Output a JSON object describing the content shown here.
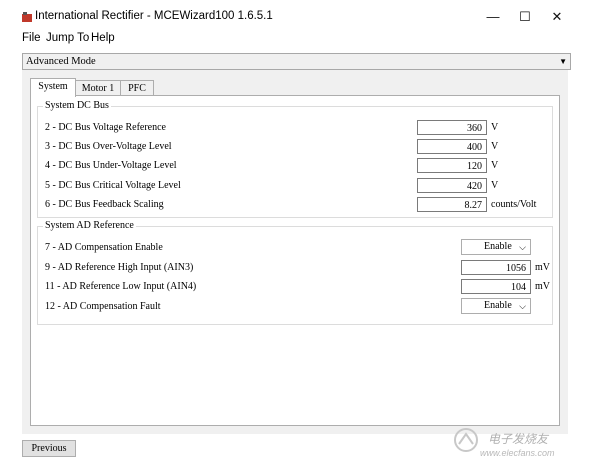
{
  "window": {
    "title": "International Rectifier - MCEWizard100 1.6.5.1",
    "minimize_glyph": "—",
    "maximize_glyph": "☐",
    "close_glyph": "✕"
  },
  "menu": {
    "items": [
      "File",
      "Jump To",
      "Help"
    ]
  },
  "mode_select": {
    "value": "Advanced Mode"
  },
  "tabs": [
    {
      "label": "System",
      "active": true
    },
    {
      "label": "Motor 1",
      "active": false
    },
    {
      "label": "PFC",
      "active": false
    }
  ],
  "dc_bus": {
    "title": "System DC Bus",
    "rows": [
      {
        "label": "2 - DC Bus Voltage Reference",
        "value": "360",
        "unit": "V"
      },
      {
        "label": "3 - DC Bus Over-Voltage Level",
        "value": "400",
        "unit": "V"
      },
      {
        "label": "4 - DC Bus Under-Voltage Level",
        "value": "120",
        "unit": "V"
      },
      {
        "label": "5 - DC Bus Critical Voltage Level",
        "value": "420",
        "unit": "V"
      },
      {
        "label": "6 - DC Bus Feedback Scaling",
        "value": "8.27",
        "unit": "counts/Volt"
      }
    ]
  },
  "ad_ref": {
    "title": "System AD Reference",
    "rows": [
      {
        "label": "7 - AD Compensation Enable",
        "select": "Enable"
      },
      {
        "label": "9 - AD Reference High Input (AIN3)",
        "value": "1056",
        "unit": "mV"
      },
      {
        "label": "11 - AD Reference Low Input (AIN4)",
        "value": "104",
        "unit": "mV"
      },
      {
        "label": "12 - AD Compensation Fault",
        "select": "Enable"
      }
    ]
  },
  "footer": {
    "previous_label": "Previous"
  },
  "watermark": {
    "text": "电子发烧友",
    "url": "www.elecfans.com"
  },
  "colors": {
    "accent_icon": "#c0392b",
    "panel_bg": "#f0f0f0"
  }
}
